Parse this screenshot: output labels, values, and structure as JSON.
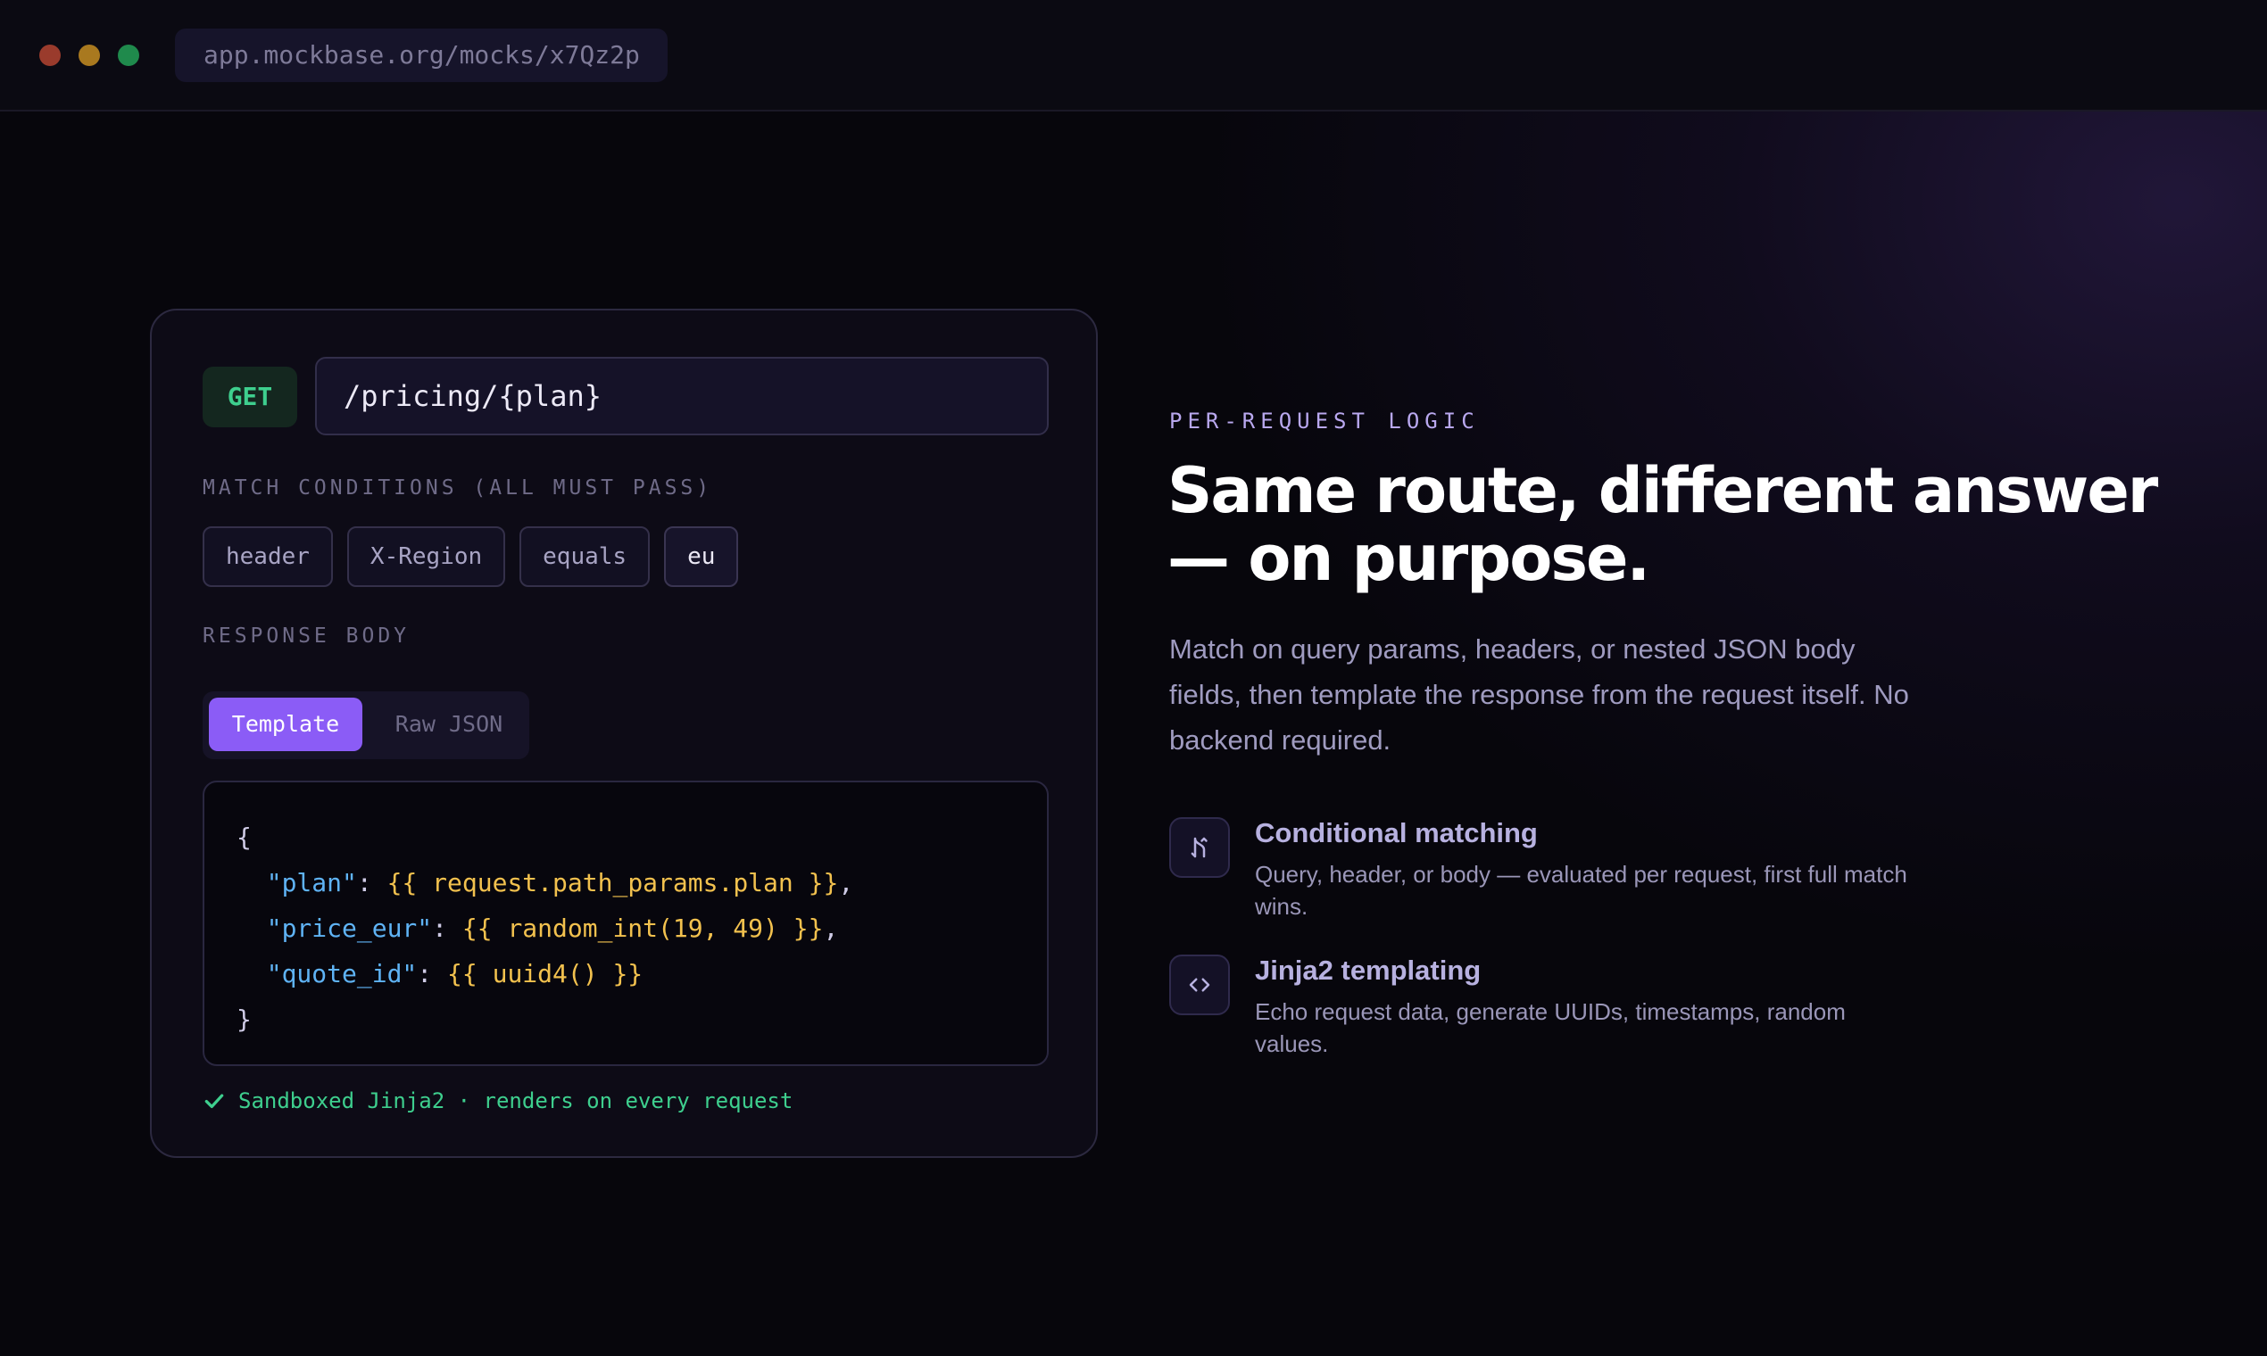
{
  "browser": {
    "url": "app.mockbase.org/mocks/x7Qz2p"
  },
  "editor": {
    "method": "GET",
    "path": "/pricing/{plan}",
    "match_label": "MATCH CONDITIONS (ALL MUST PASS)",
    "conditions": [
      "header",
      "X-Region",
      "equals",
      "eu"
    ],
    "response_label": "RESPONSE BODY",
    "tabs": [
      "Template",
      "Raw JSON"
    ],
    "active_tab": "Template",
    "code": {
      "open": "{",
      "lines": [
        {
          "key": "\"plan\"",
          "sep": ": ",
          "expr": "{{ request.path_params.plan }}",
          "end": ","
        },
        {
          "key": "\"price_eur\"",
          "sep": ": ",
          "expr": "{{ random_int(19, 49) }}",
          "end": ","
        },
        {
          "key": "\"quote_id\"",
          "sep": ": ",
          "expr": "{{ uuid4() }}",
          "end": ""
        }
      ],
      "close": "}"
    },
    "footer": "Sandboxed Jinja2 · renders on every request"
  },
  "hero": {
    "eyebrow": "PER-REQUEST LOGIC",
    "headline_lines": [
      "Same route, different answer",
      "— on purpose."
    ],
    "description_lines": [
      "Match on query params, headers, or nested JSON body",
      "fields, then template the response from the request itself. No",
      "backend required."
    ]
  },
  "features": [
    {
      "icon": "branch-icon",
      "title": "Conditional matching",
      "description_lines": [
        "Query, header, or body — evaluated per request, first full match",
        "wins."
      ]
    },
    {
      "icon": "code-brackets-icon",
      "title": "Jinja2 templating",
      "description_lines": [
        "Echo request data, generate UUIDs, timestamps, random",
        "values."
      ]
    }
  ],
  "colors": {
    "accent": "#8b5cf6",
    "method_green": "#3ecf8e",
    "json_key": "#5fb3f5",
    "template_expr": "#f2c14e",
    "background": "#07060c"
  }
}
